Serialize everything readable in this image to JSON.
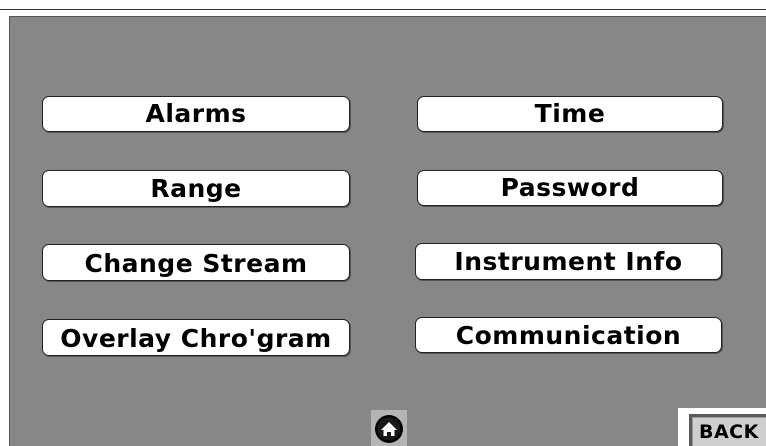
{
  "menu": {
    "alarms": "Alarms",
    "time": "Time",
    "range": "Range",
    "password": "Password",
    "change_stream": "Change Stream",
    "instrument_info": "Instrument Info",
    "overlay_chromatogram": "Overlay Chro'gram",
    "communication": "Communication"
  },
  "nav": {
    "home_icon": "home-icon",
    "back_label": "BACK"
  },
  "colors": {
    "panel_background": "#878787",
    "button_face": "#ffffff",
    "text": "#000000"
  }
}
